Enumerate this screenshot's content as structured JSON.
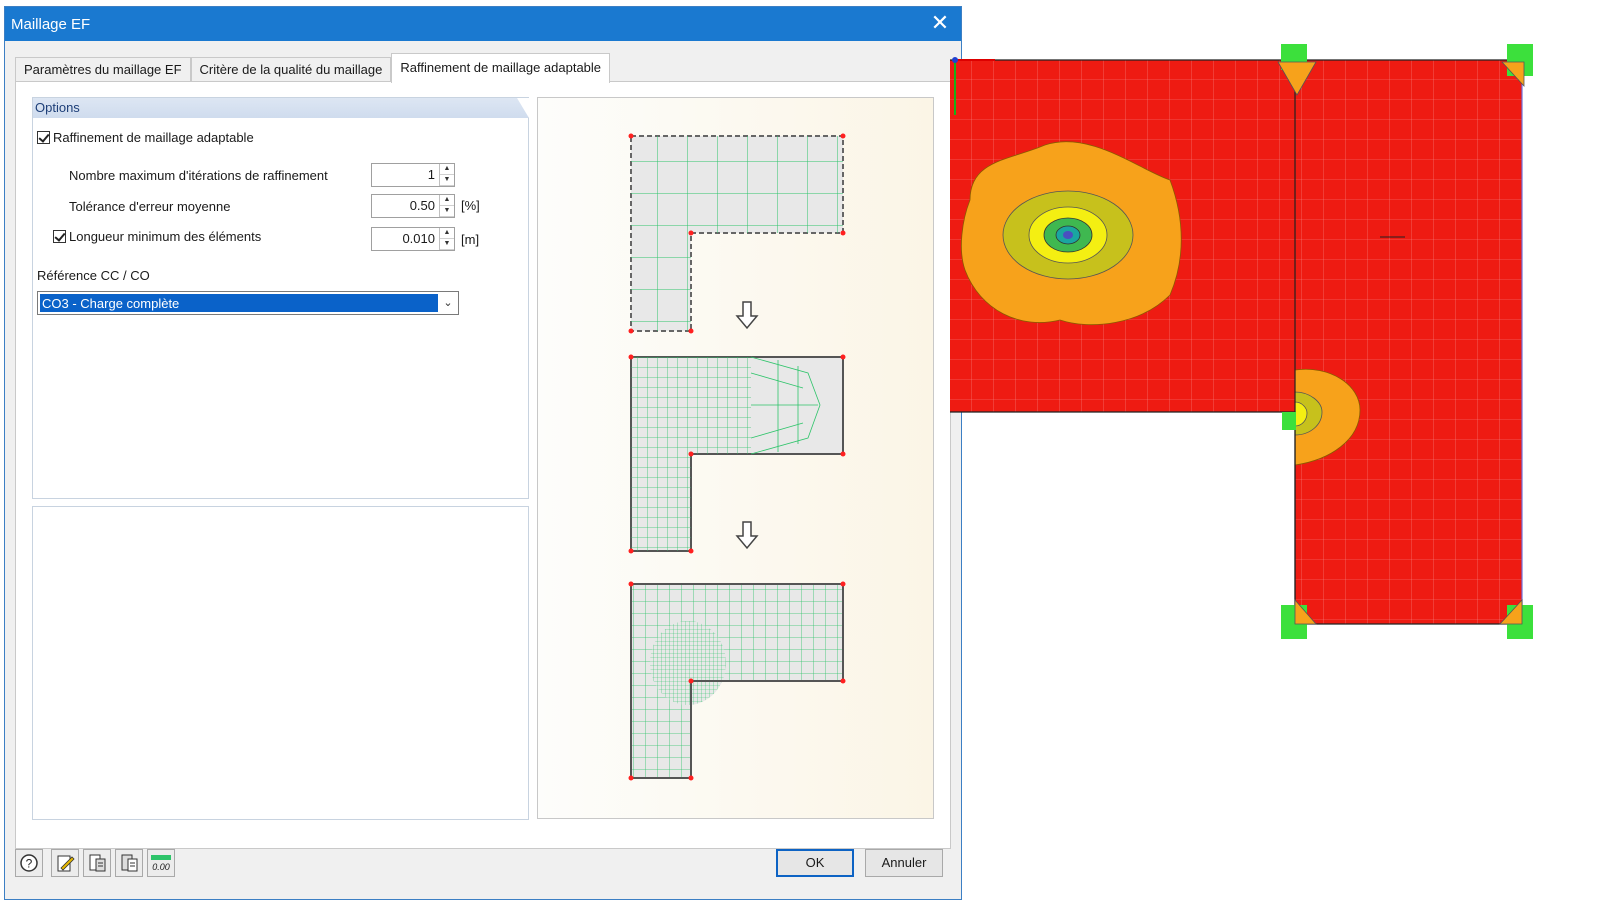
{
  "dialog": {
    "title": "Maillage EF",
    "close_label": "✕",
    "tabs": [
      {
        "label": "Paramètres du maillage EF"
      },
      {
        "label": "Critère de la qualité du maillage"
      },
      {
        "label": "Raffinement de maillage adaptable"
      }
    ],
    "options": {
      "header": "Options",
      "adaptive_refinement_label": "Raffinement de maillage adaptable",
      "adaptive_refinement_checked": true,
      "max_iterations_label": "Nombre maximum d'itérations de raffinement",
      "max_iterations_value": "1",
      "tolerance_label": "Tolérance d'erreur moyenne",
      "tolerance_value": "0.50",
      "tolerance_unit": "[%]",
      "min_length_label": "Longueur minimum des éléments",
      "min_length_checked": true,
      "min_length_value": "0.010",
      "min_length_unit": "[m]",
      "reference_label": "Référence CC / CO",
      "reference_value": "CO3 - Charge complète"
    },
    "buttons": {
      "ok": "OK",
      "cancel": "Annuler"
    },
    "toolbar_icons": [
      "help-icon",
      "edit-icon",
      "import-icon",
      "export-icon",
      "units-icon"
    ],
    "toolbar_units_text": "0.00"
  },
  "colors": {
    "title_bar": "#1a79d0",
    "selection": "#0a62c9",
    "contour_red": "#ee1b12",
    "support_green": "#3ce03c",
    "mesh_green": "#2ec46a"
  }
}
